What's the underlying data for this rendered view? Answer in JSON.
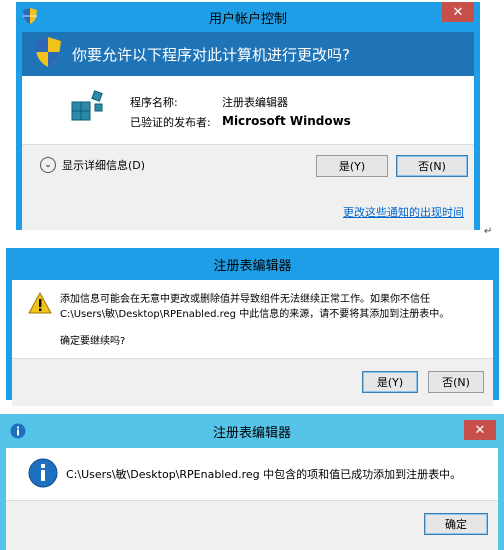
{
  "uac": {
    "title": "用户帐户控制",
    "close": "✕",
    "question": "你要允许以下程序对此计算机进行更改吗?",
    "program_label": "程序名称:",
    "program_value": "注册表编辑器",
    "publisher_label": "已验证的发布者:",
    "publisher_value": "Microsoft Windows",
    "details_label": "显示详细信息(D)",
    "yes_label": "是(Y)",
    "no_label": "否(N)",
    "link_label": "更改这些通知的出现时间"
  },
  "confirm": {
    "title": "注册表编辑器",
    "message_line1": "添加信息可能会在无意中更改或删除值并导致组件无法继续正常工作。如果你不信任",
    "message_line2": "C:\\Users\\敏\\Desktop\\RPEnabled.reg 中此信息的来源，请不要将其添加到注册表中。",
    "question": "确定要继续吗?",
    "yes_label": "是(Y)",
    "no_label": "否(N)"
  },
  "success": {
    "title": "注册表编辑器",
    "close": "✕",
    "message": "C:\\Users\\敏\\Desktop\\RPEnabled.reg 中包含的项和值已成功添加到注册表中。",
    "ok_label": "确定"
  },
  "enter_mark": "↵",
  "colors": {
    "titlebar": "#1f9ee8",
    "uac_header": "#1e74b7",
    "success_titlebar": "#56c4e8",
    "close": "#c7504a",
    "link": "#0066cc"
  }
}
